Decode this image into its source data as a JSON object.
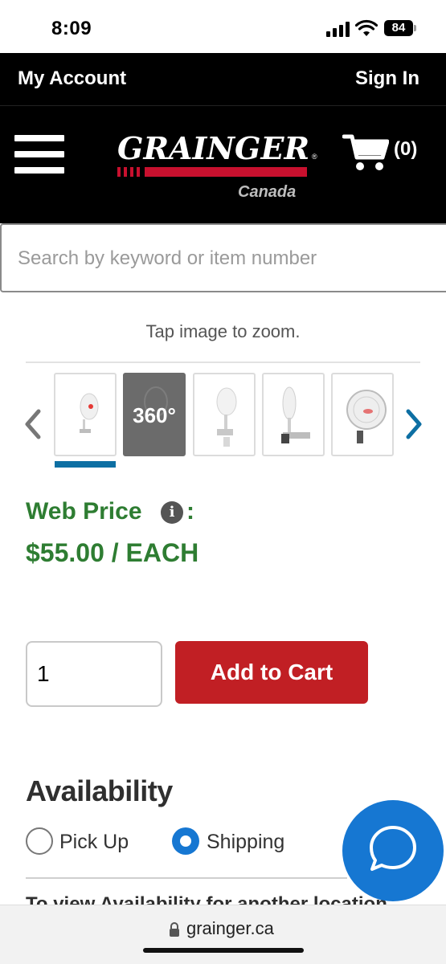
{
  "status_bar": {
    "time": "8:09",
    "battery": "84"
  },
  "account_bar": {
    "my_account": "My Account",
    "sign_in": "Sign In"
  },
  "header": {
    "logo_text": "GRAINGER",
    "logo_sub": "Canada",
    "cart_count": "(0)"
  },
  "search": {
    "placeholder": "Search by keyword or item number",
    "value": ""
  },
  "gallery": {
    "hint": "Tap image to zoom.",
    "thumb_360_label": "360°",
    "thumbnail_count": 5,
    "active_index": 0
  },
  "price": {
    "label": "Web Price",
    "colon": ":",
    "value": "$55.00 / EACH",
    "info_icon_glyph": "i"
  },
  "purchase": {
    "quantity": "1",
    "add_to_cart": "Add to Cart"
  },
  "availability": {
    "title": "Availability",
    "options": [
      {
        "label": "Pick Up",
        "selected": false
      },
      {
        "label": "Shipping",
        "selected": true
      }
    ],
    "cutoff_text": "To view Availability for another location"
  },
  "browser": {
    "url": "grainger.ca"
  },
  "colors": {
    "brand_black": "#000000",
    "brand_red": "#c8102e",
    "price_green": "#2e7d32",
    "cart_red": "#c11f24",
    "accent_blue": "#1677d2",
    "active_thumb_blue": "#0d6fa3"
  },
  "icons": [
    "signal-icon",
    "wifi-icon",
    "battery-icon",
    "menu-icon",
    "cart-icon",
    "chevron-left-icon",
    "chevron-right-icon",
    "info-icon",
    "chat-icon",
    "lock-icon"
  ]
}
